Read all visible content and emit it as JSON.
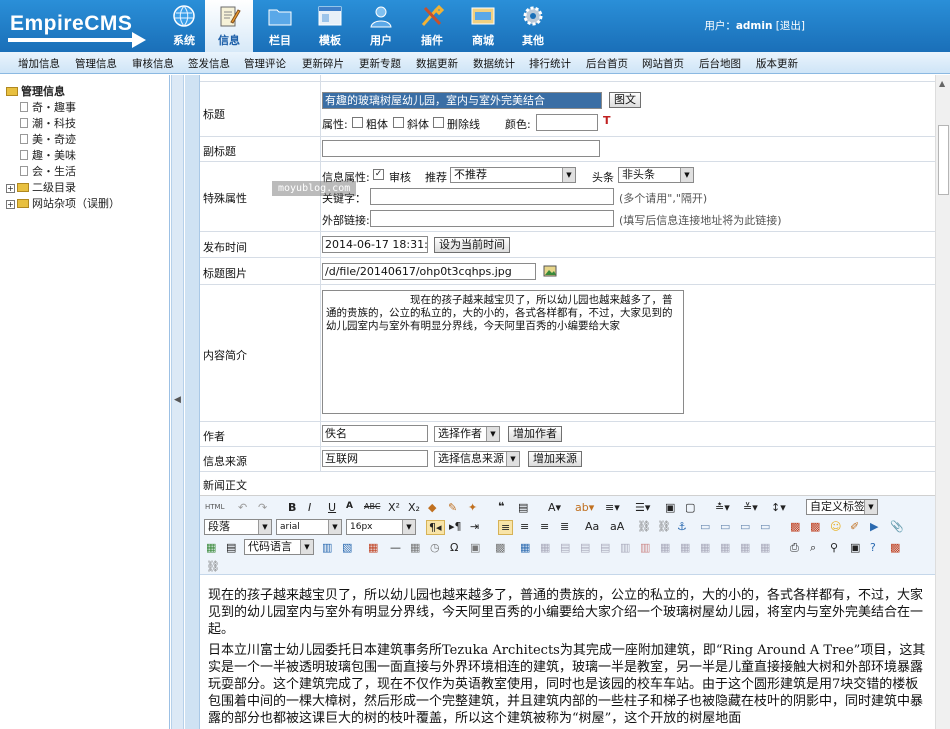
{
  "logo": {
    "text": "EmpireCMS"
  },
  "topnav": [
    {
      "label": "系统"
    },
    {
      "label": "信息"
    },
    {
      "label": "栏目"
    },
    {
      "label": "模板"
    },
    {
      "label": "用户"
    },
    {
      "label": "插件"
    },
    {
      "label": "商城"
    },
    {
      "label": "其他"
    }
  ],
  "user": {
    "prefix": "用户：",
    "name": "admin",
    "logout": "[退出]"
  },
  "subnav": [
    "增加信息",
    "管理信息",
    "审核信息",
    "签发信息",
    "管理评论",
    "更新碎片",
    "更新专题",
    "数据更新",
    "数据统计",
    "排行统计",
    "后台首页",
    "网站首页",
    "后台地图",
    "版本更新"
  ],
  "tree": {
    "root": "管理信息",
    "children": [
      "奇・趣事",
      "潮・科技",
      "美・奇迹",
      "趣・美味",
      "会・生活"
    ],
    "folders": [
      "二级目录",
      "网站杂项（误删）"
    ]
  },
  "form": {
    "title_label": "标题",
    "title_value": "有趣的玻璃树屋幼儿园，室内与室外完美结合",
    "title_btn": "图文",
    "attr_label": "属性:",
    "bold": "粗体",
    "italic": "斜体",
    "strike": "删除线",
    "color_label": "颜色:",
    "subtitle_label": "副标题",
    "special_label": "特殊属性",
    "info_attr": "信息属性:",
    "audit": "审核",
    "recommend": "推荐",
    "recommend_val": "不推荐",
    "headline": "头条",
    "headline_val": "非头条",
    "keyword_label": "关键字：",
    "keyword_hint": "(多个请用\",\"隔开)",
    "extlink_label": "外部链接:",
    "extlink_hint": "(填写后信息连接地址将为此链接)",
    "pubtime_label": "发布时间",
    "pubtime_value": "2014-06-17 18:31:04",
    "pubtime_btn": "设为当前时间",
    "titlepic_label": "标题图片",
    "titlepic_value": "/d/file/20140617/ohp0t3cqhps.jpg",
    "summary_label": "内容简介",
    "summary_value": "　　　　　　　　现在的孩子越来越宝贝了，所以幼儿园也越来越多了，普通的贵族的，公立的私立的，大的小的，各式各样都有，不过，大家见到的幼儿园室内与室外有明显分界线，今天阿里百秀的小编要给大家",
    "author_label": "作者",
    "author_value": "佚名",
    "author_sel": "选择作者",
    "author_btn": "增加作者",
    "source_label": "信息来源",
    "source_value": "互联网",
    "source_sel": "选择信息来源",
    "source_btn": "增加来源",
    "content_label": "新闻正文"
  },
  "editor": {
    "html_btn": "HTML",
    "custom_tags": "自定义标签",
    "para": "段落",
    "font": "arial",
    "size": "16px",
    "code_lang": "代码语言",
    "p1": "现在的孩子越来越宝贝了，所以幼儿园也越来越多了，普通的贵族的，公立的私立的，大的小的，各式各样都有，不过，大家见到的幼儿园室内与室外有明显分界线，今天阿里百秀的小编要给大家介绍一个玻璃树屋幼儿园，将室内与室外完美结合在一起。",
    "p2": "日本立川富士幼儿园委托日本建筑事务所Tezuka Architects为其完成一座附加建筑，即“Ring Around A Tree”项目，这其实是一个一半被透明玻璃包围一面直接与外界环境相连的建筑，玻璃一半是教室，另一半是儿童直接接触大树和外部环境暴露玩耍部分。这个建筑完成了，现在不仅作为英语教室使用，同时也是该园的校车车站。由于这个圆形建筑是用7块交错的楼板包围着中间的一棵大樟树，然后形成一个完整建筑，并且建筑内部的一些柱子和梯子也被隐藏在枝叶的阴影中，同时建筑中暴露的部分也都被这课巨大的树的枝叶覆盖，所以这个建筑被称为“树屋”，这个开放的树屋地面"
  },
  "watermark": "moyublog.com",
  "colors": {
    "topbar": "#1a6fb8",
    "accent": "#2a8fd8"
  }
}
